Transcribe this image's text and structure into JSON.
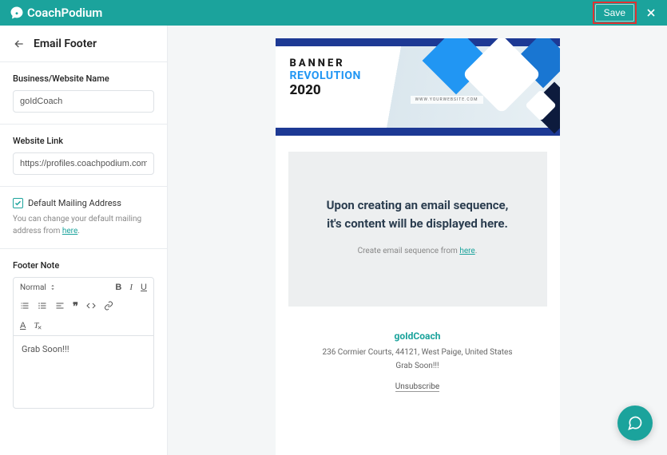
{
  "app": {
    "name": "CoachPodium"
  },
  "header": {
    "save_label": "Save"
  },
  "sidebar": {
    "title": "Email Footer",
    "fields": {
      "business_name": {
        "label": "Business/Website Name",
        "value": "goIdCoach"
      },
      "website_link": {
        "label": "Website Link",
        "value": "https://profiles.coachpodium.com/gc"
      },
      "mailing": {
        "checkbox_label": "Default Mailing Address",
        "checked": true,
        "help_text_prefix": "You can change your default mailing address from ",
        "help_text_link": "here"
      },
      "footer_note": {
        "label": "Footer Note",
        "toolbar": {
          "font": "Normal"
        },
        "value": "Grab Soon!!!"
      }
    }
  },
  "preview": {
    "banner": {
      "line1": "BANNER",
      "line2": "REVOLUTION",
      "line3": "2020",
      "url": "WWW.YOURWEBSITE.COM"
    },
    "content": {
      "line1": "Upon creating an email sequence,",
      "line2": "it's content will be displayed here.",
      "sub_prefix": "Create email sequence from ",
      "sub_link": "here"
    },
    "footer": {
      "business": "goIdCoach",
      "address": "236 Cormier Courts, 44121, West Paige, United States",
      "note": "Grab Soon!!!",
      "unsubscribe": "Unsubscribe"
    }
  }
}
